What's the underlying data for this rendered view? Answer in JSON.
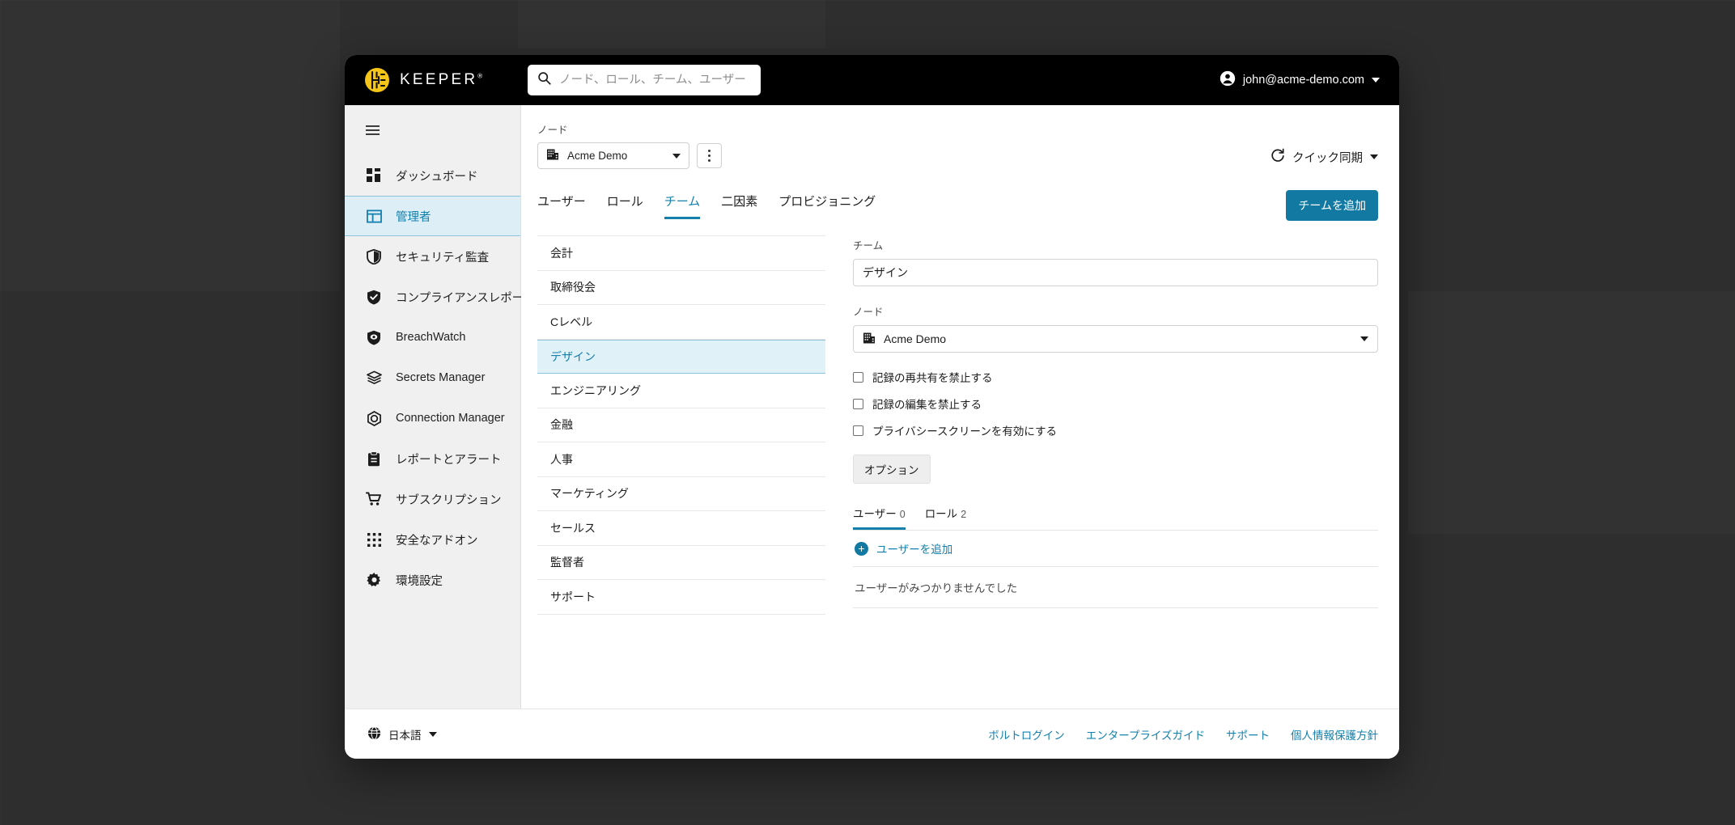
{
  "colors": {
    "accent": "#1480ad",
    "button_primary": "#1279a3",
    "topbar_bg": "#000000",
    "sidebar_bg": "#f0f0f0",
    "selected_row_bg": "#e1f1f8",
    "logo_gold": "#f5c518",
    "desktop_bg": "#2e2e2e"
  },
  "topbar": {
    "brand_name": "KEEPER",
    "brand_trademark": "®",
    "logo_icon": "keeper-logo-icon",
    "search": {
      "icon": "search-icon",
      "placeholder": "ノード、ロール、チーム、ユーザー",
      "value": ""
    },
    "user": {
      "icon": "account-circle-icon",
      "email": "john@acme-demo.com",
      "caret_icon": "chevron-down-icon"
    }
  },
  "sidebar": {
    "menu_icon": "hamburger-menu-icon",
    "items": [
      {
        "label": "ダッシュボード",
        "icon": "dashboard-grid-icon",
        "active": false
      },
      {
        "label": "管理者",
        "icon": "admin-panel-icon",
        "active": true
      },
      {
        "label": "セキュリティ監査",
        "icon": "shield-outline-icon",
        "active": false
      },
      {
        "label": "コンプライアンスレポート",
        "icon": "shield-check-icon",
        "active": false
      },
      {
        "label": "BreachWatch",
        "icon": "shield-eye-icon",
        "active": false
      },
      {
        "label": "Secrets Manager",
        "icon": "layers-icon",
        "active": false
      },
      {
        "label": "Connection Manager",
        "icon": "hexagon-ring-icon",
        "active": false
      },
      {
        "label": "レポートとアラート",
        "icon": "clipboard-icon",
        "active": false
      },
      {
        "label": "サブスクリプション",
        "icon": "shopping-cart-icon",
        "active": false
      },
      {
        "label": "安全なアドオン",
        "icon": "apps-grid-icon",
        "active": false
      },
      {
        "label": "環境設定",
        "icon": "gear-icon",
        "active": false
      }
    ]
  },
  "content": {
    "node_label": "ノード",
    "node_value": "Acme Demo",
    "node_icon": "building-icon",
    "node_caret_icon": "chevron-down-icon",
    "kebab_icon": "more-vertical-icon",
    "quick_sync": {
      "label": "クイック同期",
      "icon": "refresh-icon",
      "caret_icon": "chevron-down-icon"
    },
    "tabs": [
      {
        "label": "ユーザー",
        "active": false
      },
      {
        "label": "ロール",
        "active": false
      },
      {
        "label": "チーム",
        "active": true
      },
      {
        "label": "二因素",
        "active": false
      },
      {
        "label": "プロビジョニング",
        "active": false
      }
    ],
    "add_team_button": "チームを追加",
    "teams": [
      {
        "label": "会計",
        "selected": false
      },
      {
        "label": "取締役会",
        "selected": false
      },
      {
        "label": "Cレベル",
        "selected": false
      },
      {
        "label": "デザイン",
        "selected": true
      },
      {
        "label": "エンジニアリング",
        "selected": false
      },
      {
        "label": "金融",
        "selected": false
      },
      {
        "label": "人事",
        "selected": false
      },
      {
        "label": "マーケティング",
        "selected": false
      },
      {
        "label": "セールス",
        "selected": false
      },
      {
        "label": "監督者",
        "selected": false
      },
      {
        "label": "サポート",
        "selected": false
      }
    ]
  },
  "detail": {
    "team_label": "チーム",
    "team_name": "デザイン",
    "node_label": "ノード",
    "node_value": "Acme Demo",
    "node_icon": "building-icon",
    "node_caret_icon": "chevron-down-icon",
    "checkboxes": [
      {
        "label": "記録の再共有を禁止する",
        "checked": false
      },
      {
        "label": "記録の編集を禁止する",
        "checked": false
      },
      {
        "label": "プライバシースクリーンを有効にする",
        "checked": false
      }
    ],
    "options_button": "オプション",
    "subtabs": [
      {
        "label": "ユーザー",
        "count": "0",
        "active": true
      },
      {
        "label": "ロール",
        "count": "2",
        "active": false
      }
    ],
    "add_user_label": "ユーザーを追加",
    "add_user_icon": "plus-circle-icon",
    "empty_message": "ユーザーがみつかりませんでした"
  },
  "footer": {
    "language": {
      "label": "日本語",
      "icon": "globe-icon",
      "caret_icon": "chevron-down-icon"
    },
    "links": [
      {
        "label": "ボルトログイン"
      },
      {
        "label": "エンタープライズガイド"
      },
      {
        "label": "サポート"
      },
      {
        "label": "個人情報保護方針"
      }
    ]
  }
}
